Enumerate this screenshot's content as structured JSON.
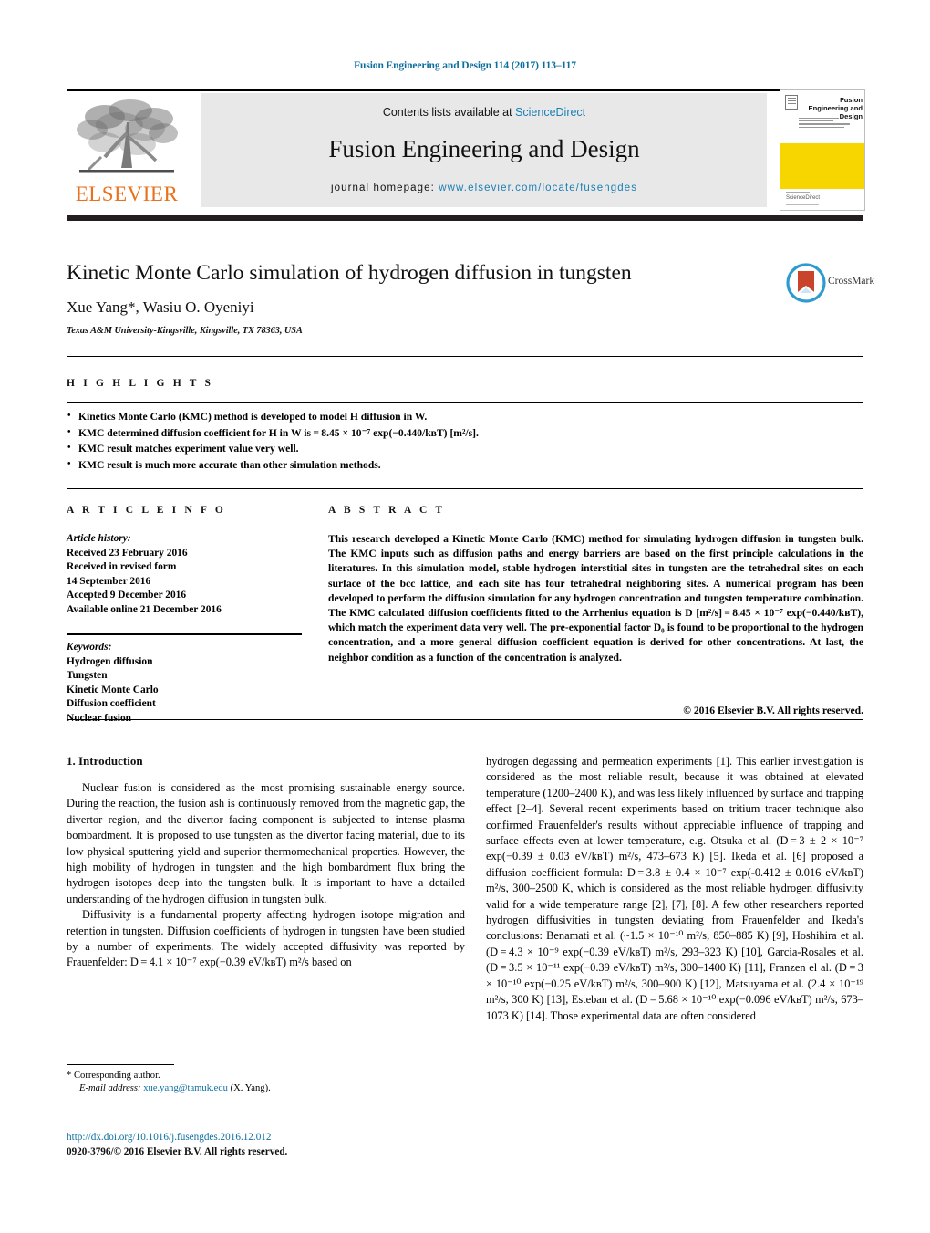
{
  "running_head": "Fusion Engineering and Design 114 (2017) 113–117",
  "masthead": {
    "contents_prefix": "Contents lists available at ",
    "contents_link": "ScienceDirect",
    "journal_name": "Fusion Engineering and Design",
    "homepage_prefix": "journal homepage: ",
    "homepage_url": "www.elsevier.com/locate/fusengdes",
    "publisher": "ELSEVIER",
    "cover": {
      "title": "Fusion Engineering and Design",
      "brand": "ScienceDirect"
    }
  },
  "article": {
    "title": "Kinetic Monte Carlo simulation of hydrogen diffusion in tungsten",
    "authors": "Xue Yang*, Wasiu O. Oyeniyi",
    "affiliation": "Texas A&M University-Kingsville, Kingsville, TX 78363, USA",
    "crossmark_label": "CrossMark"
  },
  "highlights": {
    "label": "H I G H L I G H T S",
    "items": [
      "Kinetics Monte Carlo (KMC) method is developed to model H diffusion in W.",
      "KMC determined diffusion coefficient for H in W is = 8.45 × 10⁻⁷ exp(−0.440/kʙT) [m²/s].",
      "KMC result matches experiment value very well.",
      "KMC result is much more accurate than other simulation methods."
    ]
  },
  "article_info": {
    "label": "A R T I C L E   I N F O",
    "history_header": "Article history:",
    "history": [
      "Received 23 February 2016",
      "Received in revised form",
      "14 September 2016",
      "Accepted 9 December 2016",
      "Available online 21 December 2016"
    ],
    "keywords_header": "Keywords:",
    "keywords": [
      "Hydrogen diffusion",
      "Tungsten",
      "Kinetic Monte Carlo",
      "Diffusion coefficient",
      "Nuclear fusion"
    ]
  },
  "abstract": {
    "label": "A B S T R A C T",
    "text": "This research developed a Kinetic Monte Carlo (KMC) method for simulating hydrogen diffusion in tungsten bulk. The KMC inputs such as diffusion paths and energy barriers are based on the first principle calculations in the literatures. In this simulation model, stable hydrogen interstitial sites in tungsten are the tetrahedral sites on each surface of the bcc lattice, and each site has four tetrahedral neighboring sites. A numerical program has been developed to perform the diffusion simulation for any hydrogen concentration and tungsten temperature combination. The KMC calculated diffusion coefficients fitted to the Arrhenius equation is D [m²/s] = 8.45 × 10⁻⁷ exp(−0.440/kʙT), which match the experiment data very well. The pre-exponential factor D₀ is found to be proportional to the hydrogen concentration, and a more general diffusion coefficient equation is derived for other concentrations. At last, the neighbor condition as a function of the concentration is analyzed.",
    "copyright": "© 2016 Elsevier B.V. All rights reserved."
  },
  "body": {
    "section_number_title": "1.  Introduction",
    "left_paragraph_1": "Nuclear fusion is considered as the most promising sustainable energy source. During the reaction, the fusion ash is continuously removed from the magnetic gap, the divertor region, and the divertor facing component is subjected to intense plasma bombardment. It is proposed to use tungsten as the divertor facing material, due to its low physical sputtering yield and superior thermomechanical properties. However, the high mobility of hydrogen in tungsten and the high bombardment flux bring the hydrogen isotopes deep into the tungsten bulk. It is important to have a detailed understanding of the hydrogen diffusion in tungsten bulk.",
    "left_paragraph_2": "Diffusivity is a fundamental property affecting hydrogen isotope migration and retention in tungsten. Diffusion coefficients of hydrogen in tungsten have been studied by a number of experiments. The widely accepted diffusivity was reported by Frauenfelder: D = 4.1 × 10⁻⁷ exp(−0.39 eV/kʙT) m²/s based on",
    "right_paragraph": "hydrogen degassing and permeation experiments [1]. This earlier investigation is considered as the most reliable result, because it was obtained at elevated temperature (1200–2400 K), and was less likely influenced by surface and trapping effect [2–4]. Several recent experiments based on tritium tracer technique also confirmed Frauenfelder's results without appreciable influence of trapping and surface effects even at lower temperature, e.g. Otsuka et al. (D = 3 ± 2 × 10⁻⁷ exp(−0.39 ± 0.03 eV/kʙT) m²/s, 473–673 K) [5]. Ikeda et al. [6] proposed a diffusion coefficient formula: D = 3.8 ± 0.4 × 10⁻⁷ exp(-0.412 ± 0.016 eV/kʙT) m²/s, 300–2500 K, which is considered as the most reliable hydrogen diffusivity valid for a wide temperature range [2], [7], [8]. A few other researchers reported hydrogen diffusivities in tungsten deviating from Frauenfelder and Ikeda's conclusions: Benamati et al. (~1.5 × 10⁻¹⁰ m²/s, 850–885 K) [9], Hoshihira et al. (D = 4.3 × 10⁻⁹ exp(−0.39 eV/kʙT) m²/s, 293–323 K) [10], Garcia-Rosales et al. (D = 3.5 × 10⁻¹¹ exp(−0.39 eV/kʙT) m²/s, 300–1400 K) [11], Franzen el al. (D = 3 × 10⁻¹⁰ exp(−0.25 eV/kʙT) m²/s, 300–900 K) [12], Matsuyama et al. (2.4 × 10⁻¹⁹ m²/s, 300 K) [13], Esteban et al. (D = 5.68 × 10⁻¹⁰ exp(−0.096 eV/kʙT) m²/s, 673–1073 K) [14]. Those experimental data are often considered"
  },
  "footer": {
    "corresponding_marker": "*",
    "corresponding_author": "Corresponding author.",
    "email_label": "E-mail address:",
    "email": "xue.yang@tamuk.edu",
    "email_attrib": "(X. Yang).",
    "doi": "http://dx.doi.org/10.1016/j.fusengdes.2016.12.012",
    "issn_line": "0920-3796/© 2016 Elsevier B.V. All rights reserved."
  }
}
